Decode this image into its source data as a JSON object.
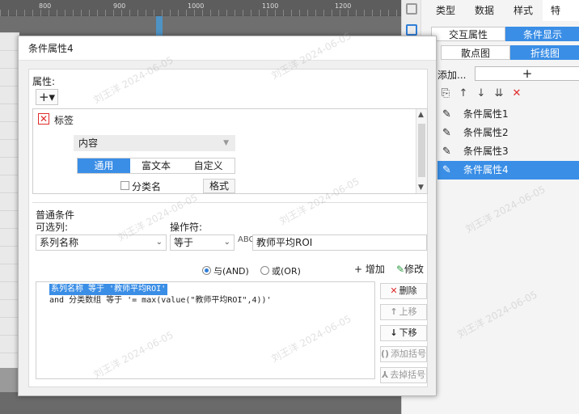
{
  "ruler": {
    "ticks": [
      "800",
      "900",
      "1000",
      "1100",
      "1200"
    ]
  },
  "right_panel": {
    "tabs": [
      "类型",
      "数据",
      "样式",
      "特"
    ],
    "subtabs": [
      "交互属性",
      "条件显示"
    ],
    "subtabs2": [
      "散点图",
      "折线图"
    ],
    "add_label": "添加...",
    "add_button": "+",
    "tools": [
      "⎘",
      "↑",
      "↓",
      "⇊",
      "✕"
    ],
    "items": [
      "条件属性1",
      "条件属性2",
      "条件属性3",
      "条件属性4"
    ]
  },
  "dialog": {
    "title": "条件属性4",
    "attr_label": "属性:",
    "attr_add": "+▾",
    "tag_label": "标签",
    "content_value": "内容",
    "format_tabs": [
      "通用",
      "富文本",
      "自定义"
    ],
    "category_label": "分类名",
    "format_button": "格式",
    "cond_title": "普通条件",
    "col_label": "可选列:",
    "op_label": "操作符:",
    "col_value": "系列名称",
    "op_value": "等于",
    "val_value": "教师平均ROI",
    "and_label": "与(AND)",
    "or_label": "或(OR)",
    "add_cond": "增加",
    "edit_cond": "修改",
    "cond_line1": "系列名称 等于 '教师平均ROI'",
    "cond_line2": "and 分类数组 等于 '= max(value(\"教师平均ROI\",4))'",
    "buttons": {
      "delete": "删除",
      "up": "上移",
      "down": "下移",
      "add_paren": "添加括号",
      "remove_paren": "去掉括号"
    }
  }
}
